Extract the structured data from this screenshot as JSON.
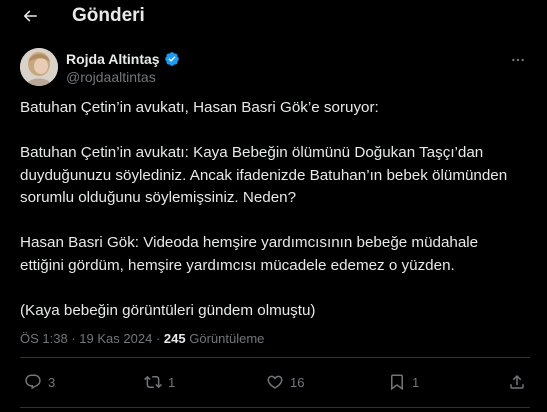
{
  "header": {
    "title": "Gönderi",
    "back_icon": "arrow-left-icon"
  },
  "author": {
    "display_name": "Rojda Altintaş",
    "handle": "@rojdaaltintas",
    "verified_icon": "verified-badge-icon",
    "more_icon": "more-horizontal-icon"
  },
  "tweet": {
    "paragraphs": [
      [
        "Batuhan Çetin’in avukatı, Hasan Basri Gök’e soruyor:"
      ],
      [
        "Batuhan Çetin’in avukatı: Kaya Bebeğin ölümünü Doğukan Taşçı’dan",
        "duyduğunuzu söylediniz. Ancak ifadenizde Batuhan’ın bebek ölümünden",
        "sorumlu olduğunu söylemişsiniz. Neden?"
      ],
      [
        "Hasan Basri Gök: Videoda hemşire yardımcısının bebeğe müdahale",
        "ettiğini gördüm, hemşire yardımcısı mücadele edemez o yüzden."
      ],
      [
        "(Kaya bebeğin görüntüleri gündem olmuştu)"
      ]
    ]
  },
  "meta": {
    "time": "ÖS 1:38",
    "separator": "·",
    "date": "19 Kas 2024",
    "views_count": "245",
    "views_label": "Görüntüleme"
  },
  "actions": {
    "reply_count": "3",
    "repost_count": "1",
    "like_count": "16",
    "bookmark_count": "1"
  },
  "colors": {
    "background": "#000000",
    "text": "#e7e9ea",
    "muted": "#71767b",
    "verified": "#1d9bf0",
    "divider": "#2f3336"
  }
}
